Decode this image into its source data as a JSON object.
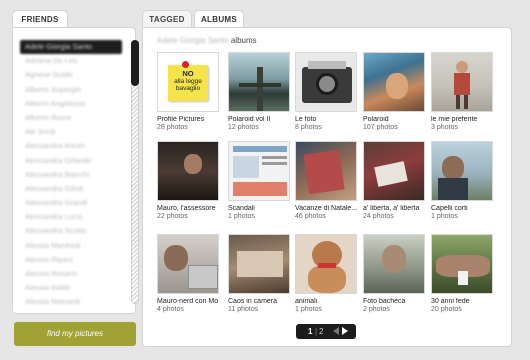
{
  "tabs": {
    "friends": "FRIENDS",
    "tagged": "TAGGED",
    "albums": "ALBUMS"
  },
  "friends": [
    "Adele Giorgia Santo",
    "Adriana De Leo",
    "Agnese Guido",
    "Alberto Supergiò",
    "Alberto Angelosso",
    "Alberto Illuore",
    "Ale Sordi",
    "Alessandra Ancini",
    "Alessandra Orlando",
    "Alessandra Bianchi",
    "Alessandra Gilioli",
    "Alessandra Grandi",
    "Alessandra Lucio",
    "Alessandra Scotto",
    "Alessia Manfredi",
    "Alessia Ripani",
    "Alessia Rosario",
    "Alessia Baldo",
    "Alessia Mainardi"
  ],
  "find_button": "find my pictures",
  "albums_header": {
    "owner": "Adele Giorgia Santo",
    "suffix": "albums"
  },
  "albums": [
    {
      "name": "Profile Pictures",
      "count": "28 photos"
    },
    {
      "name": "Polaroid vol II",
      "count": "12 photos"
    },
    {
      "name": "Le foto",
      "count": "8 photos"
    },
    {
      "name": "Polaroid",
      "count": "107 photos"
    },
    {
      "name": "le mie preferite",
      "count": "3 photos"
    },
    {
      "name": "Mauro, l'assessore",
      "count": "22 photos"
    },
    {
      "name": "Scandali",
      "count": "1 photos"
    },
    {
      "name": "Vacanze di Natale...",
      "count": "46 photos"
    },
    {
      "name": "a' liberta, a' liberta",
      "count": "24 photos"
    },
    {
      "name": "Capelli corti",
      "count": "1 photos"
    },
    {
      "name": "Mauro-nerd con Mo",
      "count": "4 photos"
    },
    {
      "name": "Caos in camera",
      "count": "11 photos"
    },
    {
      "name": "animali",
      "count": "1 photos"
    },
    {
      "name": "Foto bacheca",
      "count": "2 photos"
    },
    {
      "name": "30 anni fede",
      "count": "20 photos"
    }
  ],
  "sticky_note": {
    "line1": "NO",
    "line2": "alla legge bavaglio"
  },
  "pager": {
    "current": "1",
    "separator": "|",
    "next": "2"
  },
  "colors": {
    "background": "#e6e6e6",
    "button": "#a1a234",
    "pager": "#1c1c1c",
    "sticky": "#f5e34a"
  }
}
